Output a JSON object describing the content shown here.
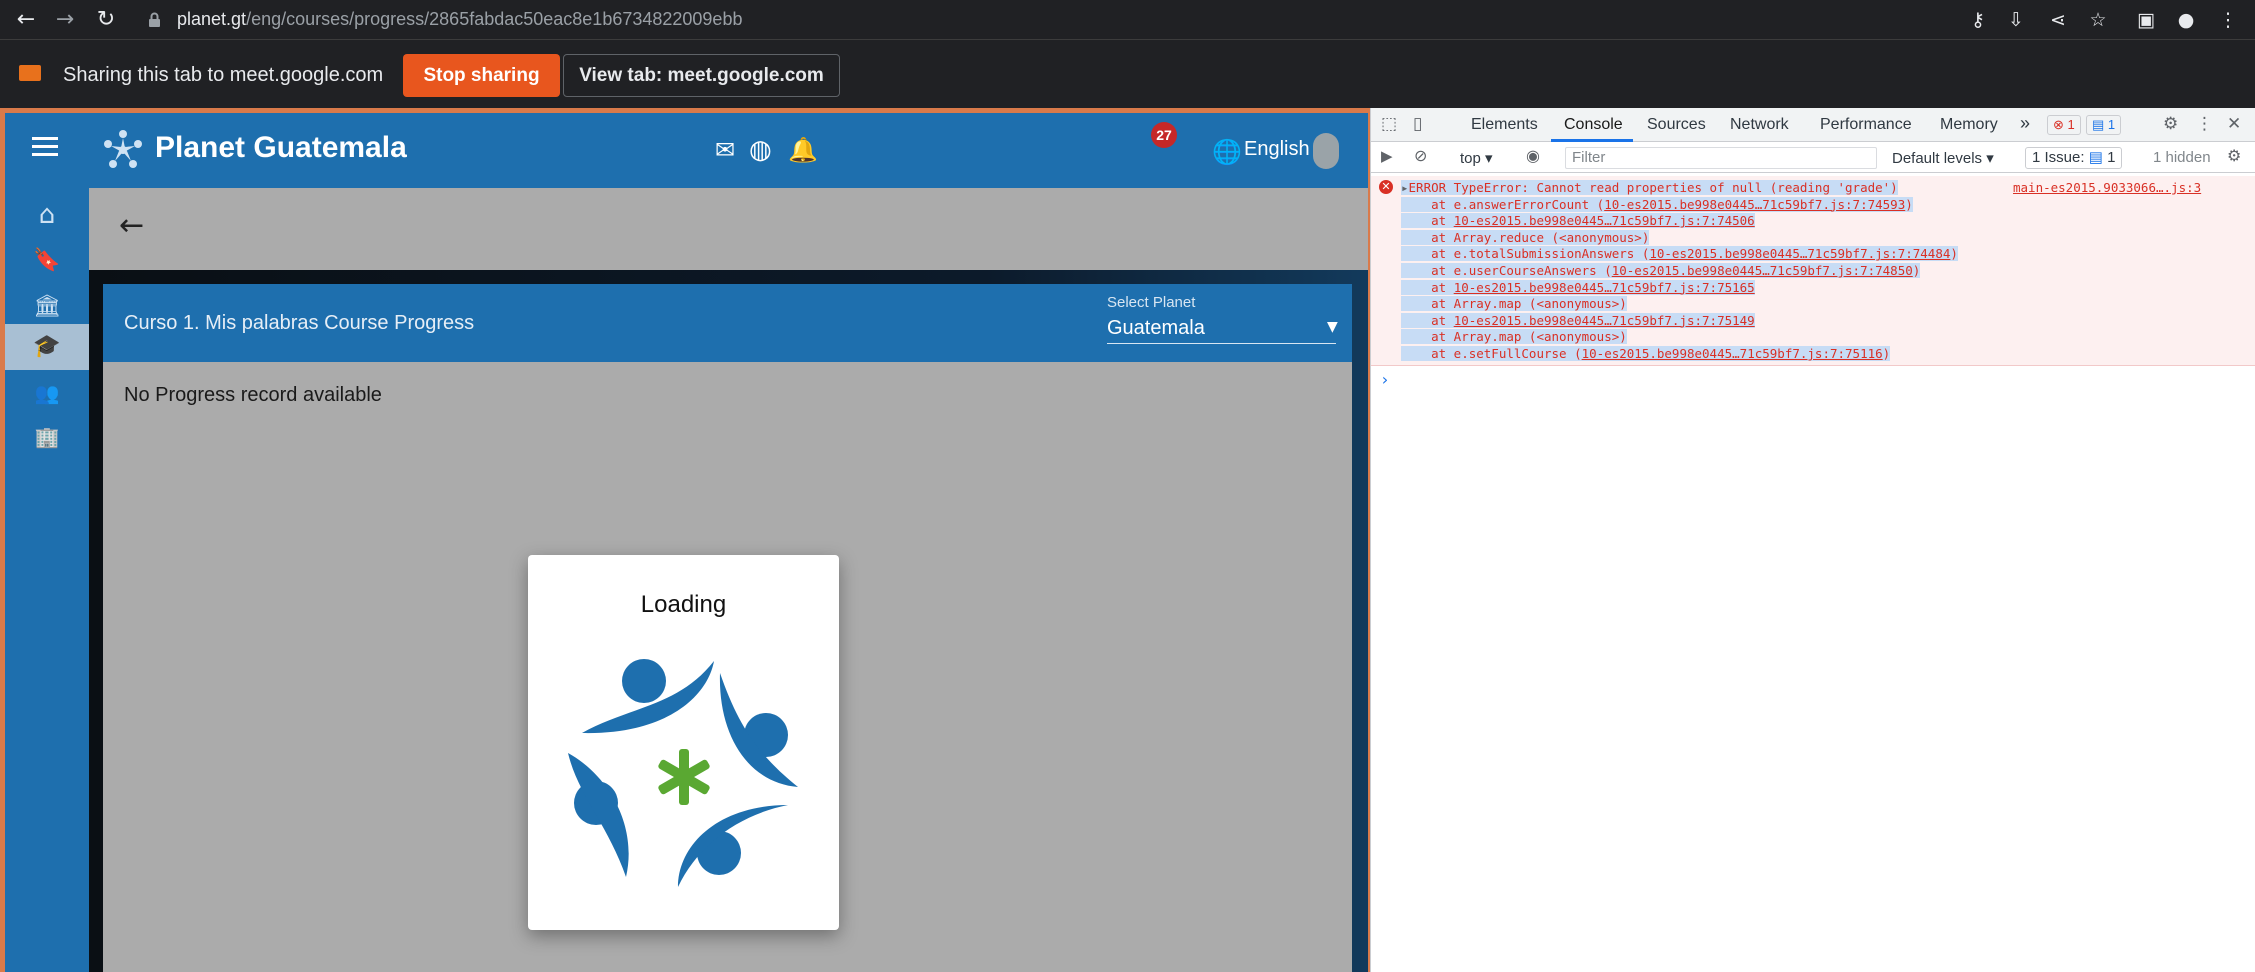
{
  "browser": {
    "url_host": "planet.gt",
    "url_path": "/eng/courses/progress/2865fabdac50eac8e1b6734822009ebb"
  },
  "share_bar": {
    "message": "Sharing this tab to meet.google.com",
    "stop_label": "Stop sharing",
    "view_label": "View tab: meet.google.com"
  },
  "app": {
    "title": "Planet Guatemala",
    "notification_count": "27",
    "language": "English",
    "brand_color": "#1e6fae"
  },
  "sidebar": {
    "items": [
      {
        "icon": "home-icon",
        "glyph": "⌂"
      },
      {
        "icon": "bookmark-icon",
        "glyph": "🔖"
      },
      {
        "icon": "library-icon",
        "glyph": "🏛"
      },
      {
        "icon": "courses-icon",
        "glyph": "🎓",
        "active": true
      },
      {
        "icon": "teams-icon",
        "glyph": "👥"
      },
      {
        "icon": "enterprises-icon",
        "glyph": "🏢"
      }
    ]
  },
  "progress_card": {
    "title": "Curso 1. Mis palabras Course Progress",
    "select_label": "Select Planet",
    "select_value": "Guatemala",
    "empty_message": "No Progress record available"
  },
  "loading_dialog": {
    "title": "Loading"
  },
  "devtools": {
    "tabs": [
      "Elements",
      "Console",
      "Sources",
      "Network",
      "Performance",
      "Memory"
    ],
    "active_tab": "Console",
    "more_tabs": "»",
    "error_count": "1",
    "message_count": "1",
    "context": "top",
    "filter_placeholder": "Filter",
    "levels": "Default levels",
    "issues_label": "1 Issue:",
    "issues_count": "1",
    "hidden": "1 hidden",
    "error_source": "main-es2015.9033066….js:3",
    "error_lines": [
      {
        "prefix": "ERROR TypeError: Cannot read properties of null (reading 'grade')",
        "link": "",
        "suffix": ""
      },
      {
        "prefix": "    at e.answerErrorCount (",
        "link": "10-es2015.be998e0445…71c59bf7.js:7:74593",
        "suffix": ")"
      },
      {
        "prefix": "    at ",
        "link": "10-es2015.be998e0445…71c59bf7.js:7:74506",
        "suffix": ""
      },
      {
        "prefix": "    at Array.reduce (<anonymous>)",
        "link": "",
        "suffix": ""
      },
      {
        "prefix": "    at e.totalSubmissionAnswers (",
        "link": "10-es2015.be998e0445…71c59bf7.js:7:74484",
        "suffix": ")"
      },
      {
        "prefix": "    at e.userCourseAnswers (",
        "link": "10-es2015.be998e0445…71c59bf7.js:7:74850",
        "suffix": ")"
      },
      {
        "prefix": "    at ",
        "link": "10-es2015.be998e0445…71c59bf7.js:7:75165",
        "suffix": ""
      },
      {
        "prefix": "    at Array.map (<anonymous>)",
        "link": "",
        "suffix": ""
      },
      {
        "prefix": "    at ",
        "link": "10-es2015.be998e0445…71c59bf7.js:7:75149",
        "suffix": ""
      },
      {
        "prefix": "    at Array.map (<anonymous>)",
        "link": "",
        "suffix": ""
      },
      {
        "prefix": "    at e.setFullCourse (",
        "link": "10-es2015.be998e0445…71c59bf7.js:7:75116",
        "suffix": ")"
      }
    ]
  }
}
